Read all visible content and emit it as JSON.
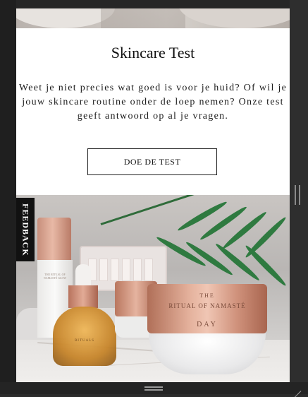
{
  "card": {
    "title": "Skincare Test",
    "description": "Weet je niet precies wat goed is voor je huid? Of wil je jouw skincare routine onder de loep nemen? Onze test geeft antwoord op al je vragen.",
    "cta_label": "DOE DE TEST"
  },
  "photo": {
    "jar_label_line1": "THE",
    "jar_label_line2": "RITUAL OF NAMASTÉ",
    "jar_label_line3": "DAY",
    "bottle_label": "THE RITUAL OF NAMASTÉ GLOW",
    "serum_label": "RITUALS"
  },
  "feedback": {
    "label": "FEEDBACK"
  },
  "colors": {
    "accent_rose_gold": "#e2ab96",
    "cta_border": "#222222",
    "feedback_bg": "#111111"
  }
}
